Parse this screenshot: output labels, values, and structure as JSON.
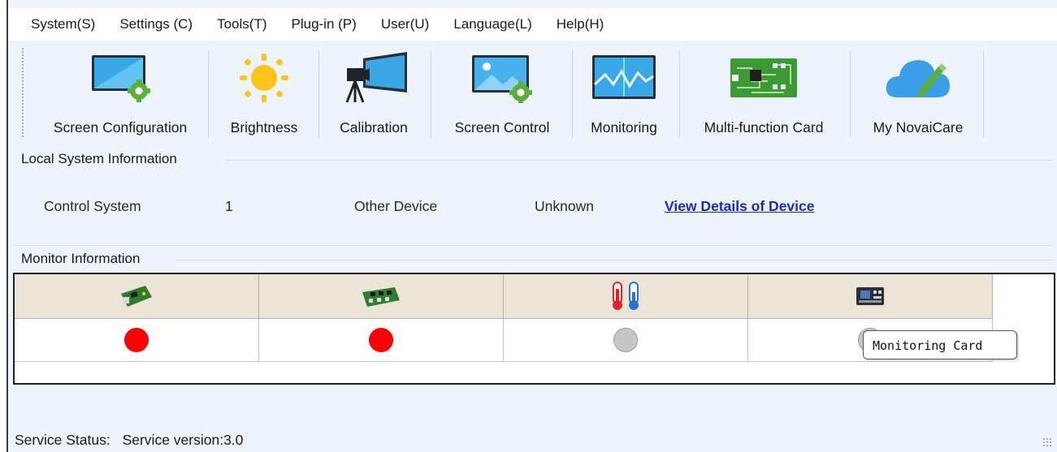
{
  "menu": [
    "System(S)",
    "Settings (C)",
    "Tools(T)",
    "Plug-in (P)",
    "User(U)",
    "Language(L)",
    "Help(H)"
  ],
  "toolbar": [
    {
      "label": "Screen Configuration",
      "icon": "screen-config-icon"
    },
    {
      "label": "Brightness",
      "icon": "sun-icon"
    },
    {
      "label": "Calibration",
      "icon": "camera-calibration-icon"
    },
    {
      "label": "Screen Control",
      "icon": "screen-control-icon"
    },
    {
      "label": "Monitoring",
      "icon": "monitoring-icon"
    },
    {
      "label": "Multi-function Card",
      "icon": "circuit-card-icon"
    },
    {
      "label": "My NovaiCare",
      "icon": "cloud-icon"
    }
  ],
  "local_system": {
    "title": "Local System Information",
    "control_label": "Control System",
    "control_value": "1",
    "other_label": "Other Device",
    "other_value": "Unknown",
    "details_link": "View Details of Device"
  },
  "monitor": {
    "title": "Monitor Information",
    "columns": [
      {
        "icon": "sending-card-icon",
        "status": "red"
      },
      {
        "icon": "receiving-card-icon",
        "status": "red"
      },
      {
        "icon": "thermometer-icon",
        "status": "grey"
      },
      {
        "icon": "monitoring-card-icon",
        "status": "grey"
      }
    ],
    "tooltip": "Monitoring Card"
  },
  "status": {
    "label": "Service Status:",
    "version": "Service version:3.0"
  },
  "colors": {
    "status_red": "#ff0000",
    "status_grey": "#c6c6c6",
    "link": "#1a29c8"
  }
}
